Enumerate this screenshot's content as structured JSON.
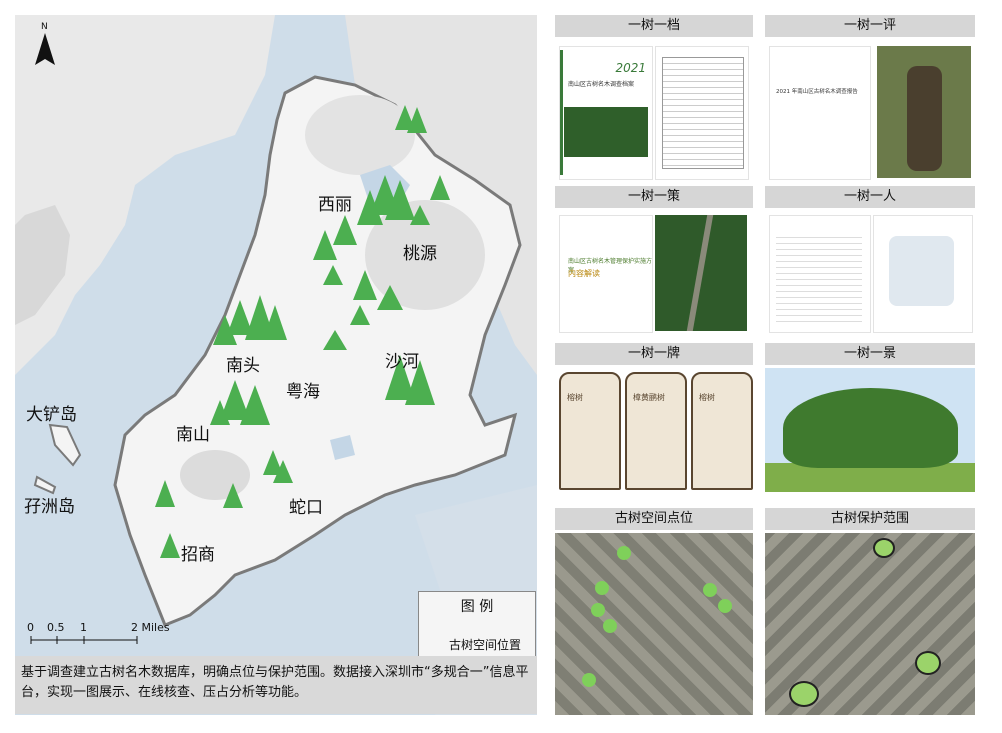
{
  "map": {
    "north_label": "N",
    "places": [
      "西丽",
      "桃源",
      "南头",
      "粤海",
      "沙河",
      "南山",
      "大铲岛",
      "孖洲岛",
      "蛇口",
      "招商"
    ],
    "legend": {
      "title": "图 例",
      "item": "古树空间位置"
    },
    "scale": {
      "ticks": [
        "0",
        "0.5",
        "1",
        "2 Miles"
      ]
    },
    "colors": {
      "sea": "#cfdde9",
      "land": "#f2f2f2",
      "boundary": "#7a7a7a",
      "tree": "#4caf50"
    }
  },
  "caption": "基于调查建立古树名木数据库，明确点位与保护范围。数据接入深圳市“多规合一”信息平台，实现一图展示、在线核查、压占分析等功能。",
  "cards": {
    "c1": {
      "title": "一树一档",
      "year": "2021",
      "doc_title": "南山区古树名木调查档案"
    },
    "c2": {
      "title": "一树一评",
      "doc_title": "2021 年南山区古树名木调查报告"
    },
    "c3": {
      "title": "一树一策",
      "doc_title": "南山区古树名木管理保护实施方案",
      "doc_sub": "内容解读"
    },
    "c4": {
      "title": "一树一人"
    },
    "c5": {
      "title": "一树一牌",
      "signs": [
        "榕树",
        "樟黄鹂树",
        "榕树"
      ]
    },
    "c6": {
      "title": "一树一景"
    },
    "c7": {
      "title": "古树空间点位"
    },
    "c8": {
      "title": "古树保护范围"
    }
  }
}
